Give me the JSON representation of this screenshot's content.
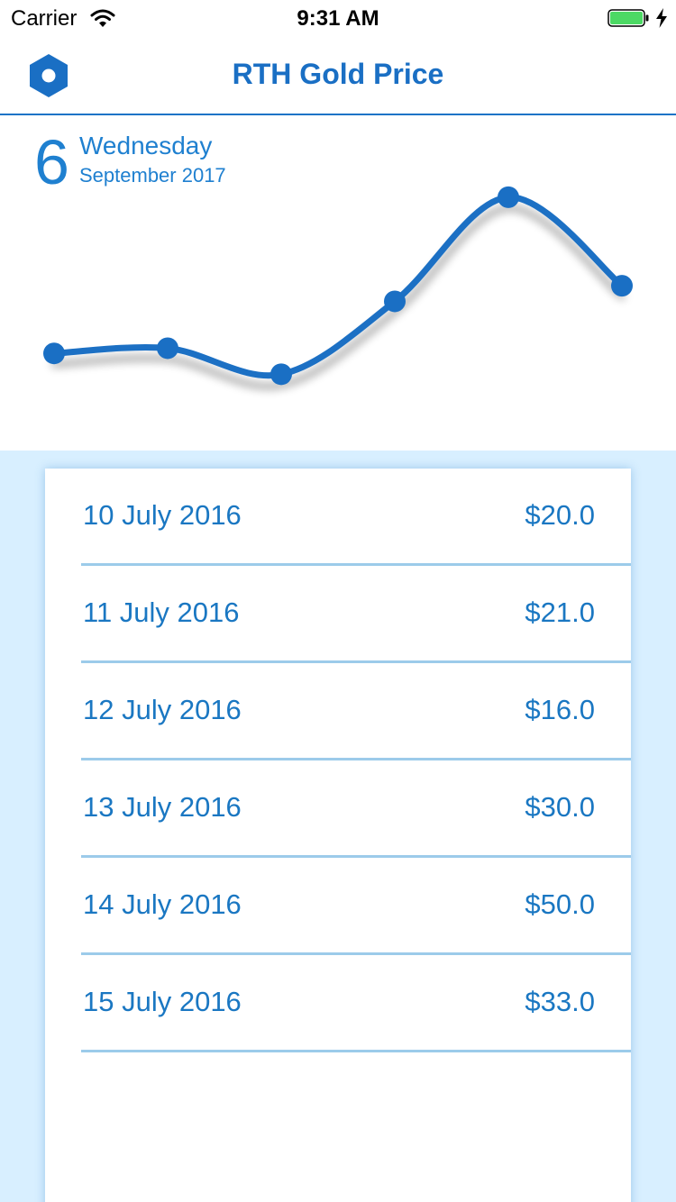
{
  "status_bar": {
    "carrier": "Carrier",
    "time": "9:31 AM"
  },
  "nav": {
    "title": "RTH Gold Price",
    "settings_icon": "hexagon-settings-icon"
  },
  "date_header": {
    "day": "6",
    "weekday": "Wednesday",
    "month_year": "September 2017"
  },
  "colors": {
    "accent": "#1a6fc4",
    "list_background": "#d8efff",
    "divider": "#9ccbea"
  },
  "chart_data": {
    "type": "line",
    "x": [
      "10 July 2016",
      "11 July 2016",
      "12 July 2016",
      "13 July 2016",
      "14 July 2016",
      "15 July 2016"
    ],
    "values": [
      20.0,
      21.0,
      16.0,
      30.0,
      50.0,
      33.0
    ],
    "ylim": [
      10,
      55
    ],
    "grid": false,
    "smooth": true
  },
  "prices": [
    {
      "date": "10 July 2016",
      "price": "$20.0"
    },
    {
      "date": "11 July 2016",
      "price": "$21.0"
    },
    {
      "date": "12 July 2016",
      "price": "$16.0"
    },
    {
      "date": "13 July 2016",
      "price": "$30.0"
    },
    {
      "date": "14 July 2016",
      "price": "$50.0"
    },
    {
      "date": "15 July 2016",
      "price": "$33.0"
    }
  ]
}
